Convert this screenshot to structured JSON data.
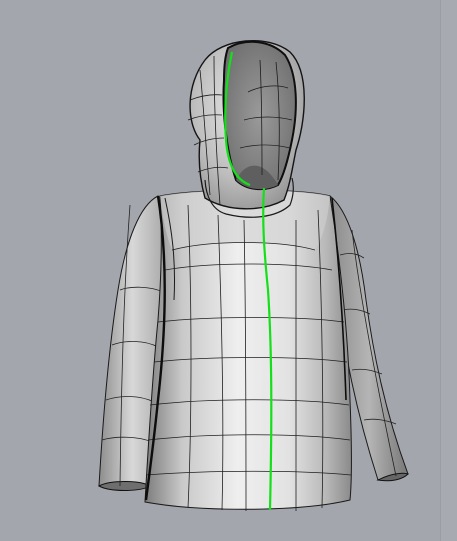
{
  "viewport": {
    "background": "#a3a6ad",
    "view_type": "perspective-3d",
    "shading": "shaded",
    "object": "hooded-jacket-surface-model",
    "seam_color": "#14e01a",
    "edge_color": "#111111",
    "surface_light": "#ececec",
    "surface_dark": "#7f7f7f"
  }
}
